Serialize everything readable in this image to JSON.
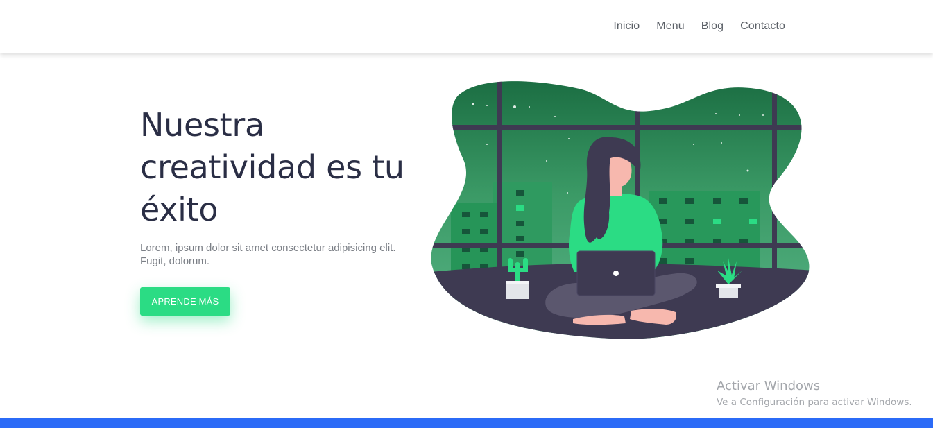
{
  "nav": {
    "links": [
      {
        "label": "Inicio"
      },
      {
        "label": "Menu"
      },
      {
        "label": "Blog"
      },
      {
        "label": "Contacto"
      }
    ]
  },
  "hero": {
    "title": "Nuestra creatividad es tu éxito",
    "description": "Lorem, ipsum dolor sit amet consectetur adipisicing elit. Fugit, dolorum.",
    "button_label": "APRENDE MÁS"
  },
  "illustration": {
    "icon": "woman-with-laptop-illustration",
    "colors": {
      "accent": "#2bdc84",
      "dark": "#3e3a52",
      "sky": "#1c7a48"
    }
  },
  "watermark": {
    "title": "Activar Windows",
    "subtitle": "Ve a Configuración para activar Windows."
  },
  "colors": {
    "accent": "#2bdc84",
    "footer": "#2b6bf7",
    "text": "#2a2e45"
  }
}
